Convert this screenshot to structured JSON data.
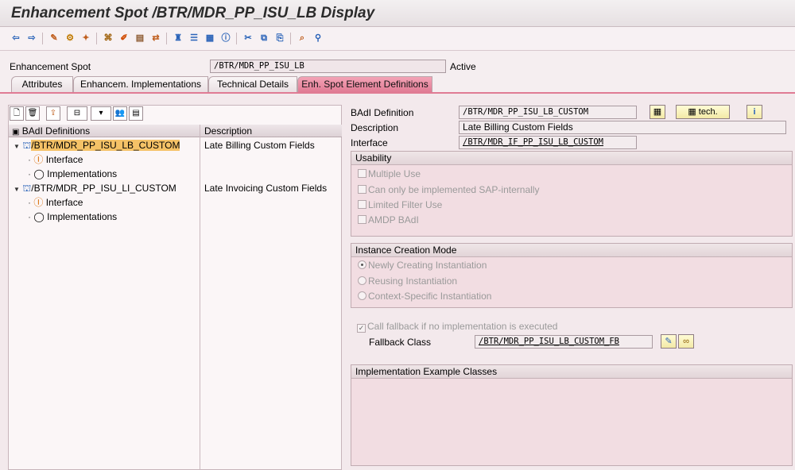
{
  "title": "Enhancement Spot /BTR/MDR_PP_ISU_LB Display",
  "header": {
    "spot_label": "Enhancement Spot",
    "spot_value": "/BTR/MDR_PP_ISU_LB",
    "status": "Active"
  },
  "tabs": [
    {
      "label": "Attributes"
    },
    {
      "label": "Enhancem. Implementations"
    },
    {
      "label": "Technical Details"
    },
    {
      "label": "Enh. Spot Element Definitions"
    }
  ],
  "tree": {
    "col_definitions": "BAdI Definitions",
    "col_description": "Description",
    "rows": [
      {
        "label": "/BTR/MDR_PP_ISU_LB_CUSTOM",
        "description": "Late Billing Custom Fields"
      },
      {
        "label": "Interface",
        "description": ""
      },
      {
        "label": "Implementations",
        "description": ""
      },
      {
        "label": "/BTR/MDR_PP_ISU_LI_CUSTOM",
        "description": "Late Invoicing Custom Fields"
      },
      {
        "label": "Interface",
        "description": ""
      },
      {
        "label": "Implementations",
        "description": ""
      }
    ]
  },
  "detail": {
    "badi_label": "BAdI Definition",
    "badi_value": "/BTR/MDR_PP_ISU_LB_CUSTOM",
    "tech_button": "tech.",
    "description_label": "Description",
    "description_value": "Late Billing Custom Fields",
    "interface_label": "Interface",
    "interface_value": "/BTR/MDR_IF_PP_ISU_LB_CUSTOM",
    "usability": {
      "title": "Usability",
      "options": [
        "Multiple Use",
        "Can only be implemented SAP-internally",
        "Limited Filter Use",
        "AMDP BAdI"
      ]
    },
    "instance": {
      "title": "Instance Creation Mode",
      "options": [
        "Newly Creating Instantiation",
        "Reusing Instantiation",
        "Context-Specific Instantiation"
      ]
    },
    "fallback_check": "Call fallback if no implementation is executed",
    "fallback_label": "Fallback Class",
    "fallback_value": "/BTR/MDR_PP_ISU_LB_CUSTOM_FB",
    "examples_title": "Implementation Example Classes"
  },
  "colors": {
    "accent": "#e07b94",
    "highlight": "#f5c267"
  }
}
